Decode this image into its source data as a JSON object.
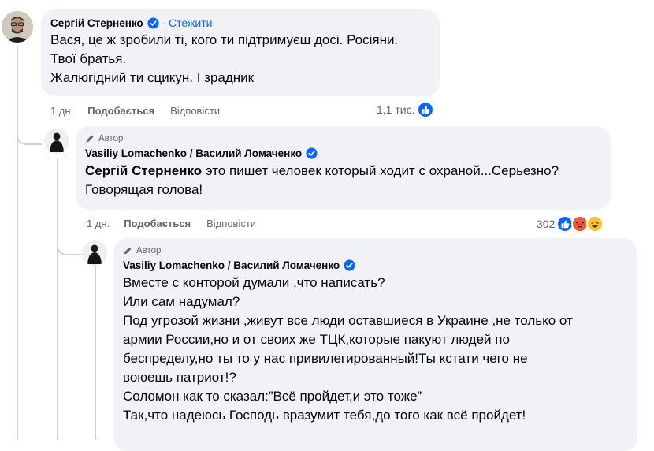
{
  "comment1": {
    "author": "Сергій Стерненко",
    "follow": "Стежити",
    "separator": "·",
    "lines": [
      "Вася, це ж зробили ті, кого ти підтримуєш досі. Росіяни.",
      "Твої братья.",
      "Жалюгідний ти сцикун. І зрадник"
    ],
    "time": "1 дн.",
    "like": "Подобається",
    "reply": "Відповісти",
    "reaction_count": "1,1 тис."
  },
  "comment2": {
    "badge": "Автор",
    "author": "Vasiliy Lomachenko / Василий Ломаченко",
    "mention": "Сергій Стерненко",
    "line1_rest": " это пишет человек который ходит с охраной...Серьезно?",
    "line2": "Говорящая голова!",
    "time": "1 дн.",
    "like": "Подобається",
    "reply": "Відповісти",
    "reaction_count": "302"
  },
  "comment3": {
    "badge": "Автор",
    "author": "Vasiliy Lomachenko / Василий Ломаченко",
    "lines": [
      "Вместе с конторой думали ,что написать?",
      "Или сам надумал?",
      "Под угрозой жизни ,живут все люди оставшиеся в Украине ,не только от",
      "армии России,но и от своих же ТЦК,которые пакуют людей по",
      "беспределу,но ты то у нас привилегированный!Ты кстати чего не",
      "воюешь патриот!?",
      "Соломон как то сказал:”Всё пройдет,и это тоже”",
      "Так,что надеюсь Господь вразумит тебя,до того как всё пройдет!"
    ]
  },
  "colors": {
    "accent": "#0866ff",
    "bubble": "#f0f2f5",
    "secondary_text": "#65676b",
    "thread_line": "#ced0d4"
  },
  "icons": {
    "verified": "verified-badge-icon",
    "pencil": "pencil-icon",
    "like": "like-reaction-icon",
    "angry": "angry-reaction-icon",
    "haha": "haha-reaction-icon"
  }
}
